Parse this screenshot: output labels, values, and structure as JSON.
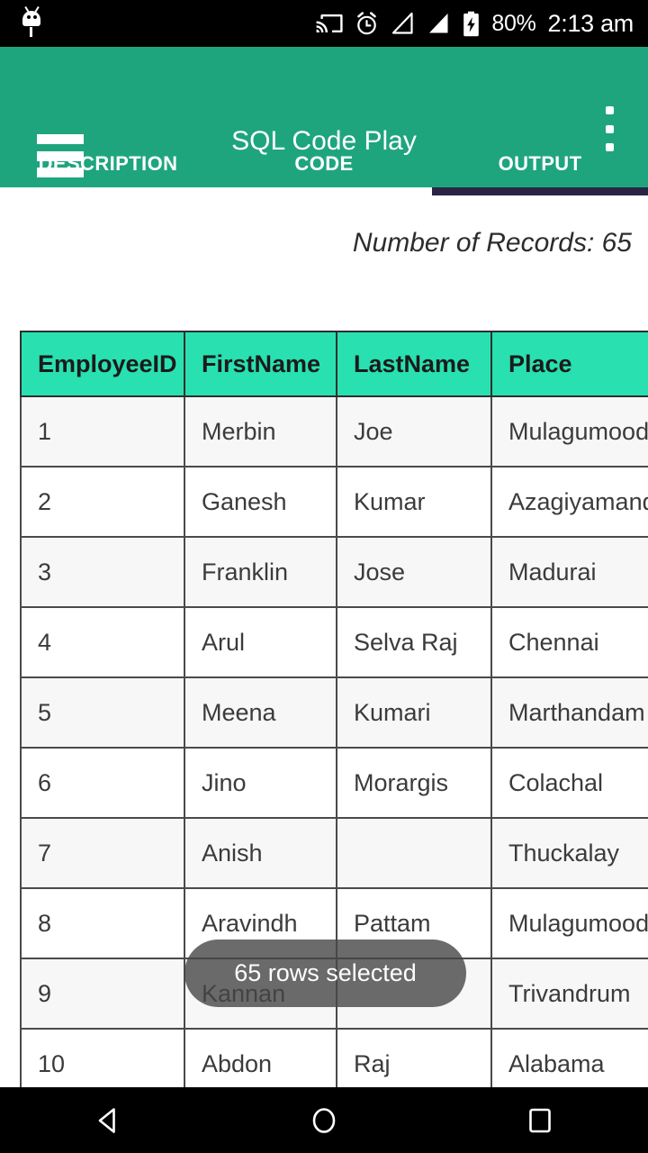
{
  "status_bar": {
    "battery_percent": "80%",
    "clock": "2:13 am",
    "icons": [
      "android-droid-icon",
      "cast-icon",
      "alarm-icon",
      "signal-empty-icon",
      "signal-full-icon",
      "battery-charging-icon"
    ]
  },
  "app_bar": {
    "title": "SQL Code Play",
    "menu_icon": "hamburger-menu-icon",
    "overflow_icon": "overflow-menu-icon",
    "accent_color": "#1ea57e"
  },
  "tabs": {
    "items": [
      {
        "label": "DESCRIPTION",
        "selected": false
      },
      {
        "label": "CODE",
        "selected": false
      },
      {
        "label": "OUTPUT",
        "selected": true
      }
    ],
    "indicator_color": "#2a2545"
  },
  "output": {
    "record_count_text": "Number of Records: 65",
    "table": {
      "header_color": "#29e0b0",
      "columns": [
        "EmployeeID",
        "FirstName",
        "LastName",
        "Place"
      ],
      "rows": [
        {
          "id": "1",
          "first": "Merbin",
          "last": "Joe",
          "place": "Mulagumoodu"
        },
        {
          "id": "2",
          "first": "Ganesh",
          "last": "Kumar",
          "place": "Azagiyamandapam"
        },
        {
          "id": "3",
          "first": "Franklin",
          "last": "Jose",
          "place": "Madurai"
        },
        {
          "id": "4",
          "first": "Arul",
          "last": "Selva Raj",
          "place": "Chennai"
        },
        {
          "id": "5",
          "first": "Meena",
          "last": "Kumari",
          "place": "Marthandam"
        },
        {
          "id": "6",
          "first": "Jino",
          "last": "Morargis",
          "place": "Colachal"
        },
        {
          "id": "7",
          "first": "Anish",
          "last": "",
          "place": "Thuckalay"
        },
        {
          "id": "8",
          "first": "Aravindh",
          "last": "Pattam",
          "place": "Mulagumoodu"
        },
        {
          "id": "9",
          "first": "Kannan",
          "last": "",
          "place": "Trivandrum"
        },
        {
          "id": "10",
          "first": "Abdon",
          "last": "Raj",
          "place": "Alabama"
        }
      ]
    }
  },
  "toast": {
    "message": "65 rows selected"
  },
  "nav_bar": {
    "back": "back-icon",
    "home": "home-icon",
    "recents": "recents-icon"
  }
}
